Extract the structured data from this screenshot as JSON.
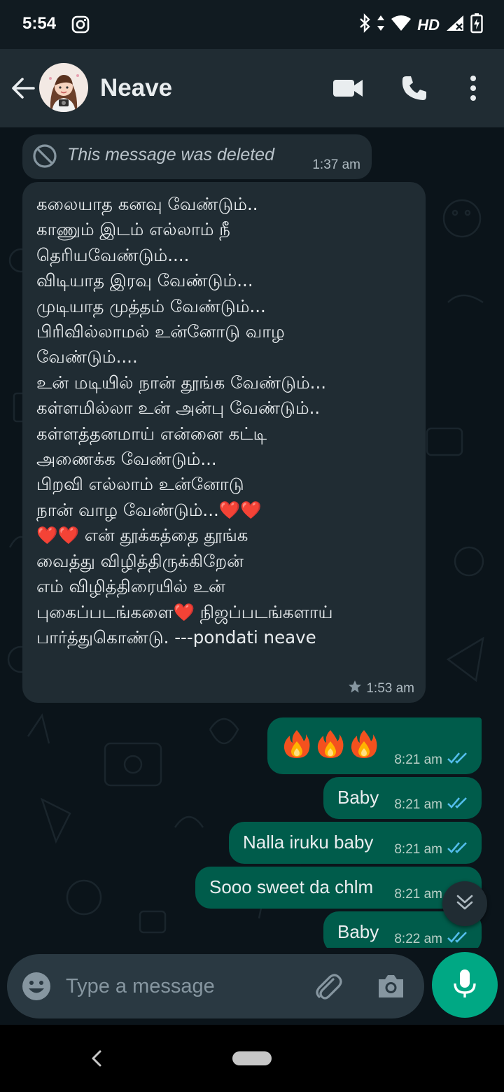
{
  "status_bar": {
    "time": "5:54",
    "network_label": "HD"
  },
  "header": {
    "contact_name": "Neave"
  },
  "messages": {
    "deleted": {
      "text": "This message was deleted",
      "time": "1:37 am"
    },
    "poem": {
      "text": "கலையாத கனவு வேண்டும்..\nகாணும் இடம் எல்லாம் நீ\nதெரியவேண்டும்....\nவிடியாத இரவு வேண்டும்...\nமுடியாத முத்தம் வேண்டும்...\nபிரிவில்லாமல் உன்னோடு வாழ\nவேண்டும்....\nஉன் மடியில் நான் தூங்க வேண்டும்...\nகள்ளமில்லா உன் அன்பு வேண்டும்..\nகள்ளத்தனமாய் என்னை கட்டி\nஅணைக்க வேண்டும்...\nபிறவி எல்லாம் உன்னோடு\nநான் வாழ வேண்டும்...❤️❤️\n❤️❤️   என் தூக்கத்தை தூங்க\nவைத்து விழித்திருக்கிறேன்\nஎம் விழித்திரையில் உன்\nபுகைப்படங்களை❤️ நிஜப்படங்களாய்\nபார்த்துகொண்டு. ---pondati neave",
      "time": "1:53 am",
      "starred": true
    },
    "outgoing": [
      {
        "text": "🔥🔥🔥",
        "time": "8:21 am",
        "status": "read"
      },
      {
        "text": "Baby",
        "time": "8:21 am",
        "status": "read"
      },
      {
        "text": "Nalla iruku baby",
        "time": "8:21 am",
        "status": "read"
      },
      {
        "text": "Sooo sweet da chlm",
        "time": "8:21 am",
        "status": "read"
      },
      {
        "text": "Baby",
        "time": "8:22 am",
        "status": "read"
      }
    ]
  },
  "composer": {
    "placeholder": "Type a message"
  },
  "colors": {
    "header_bg": "#202c33",
    "chat_bg": "#0b141a",
    "incoming_bubble": "#202c33",
    "outgoing_bubble": "#005c4b",
    "read_tick": "#53bdeb",
    "accent": "#00a884"
  },
  "icons": {
    "status": [
      "instagram-icon",
      "bluetooth-icon",
      "data-arrows-icon",
      "wifi-icon",
      "signal-icon",
      "battery-icon"
    ],
    "header": [
      "back-arrow-icon",
      "video-call-icon",
      "voice-call-icon",
      "more-options-icon"
    ],
    "composer": [
      "emoji-icon",
      "attach-icon",
      "camera-icon",
      "mic-icon"
    ]
  }
}
